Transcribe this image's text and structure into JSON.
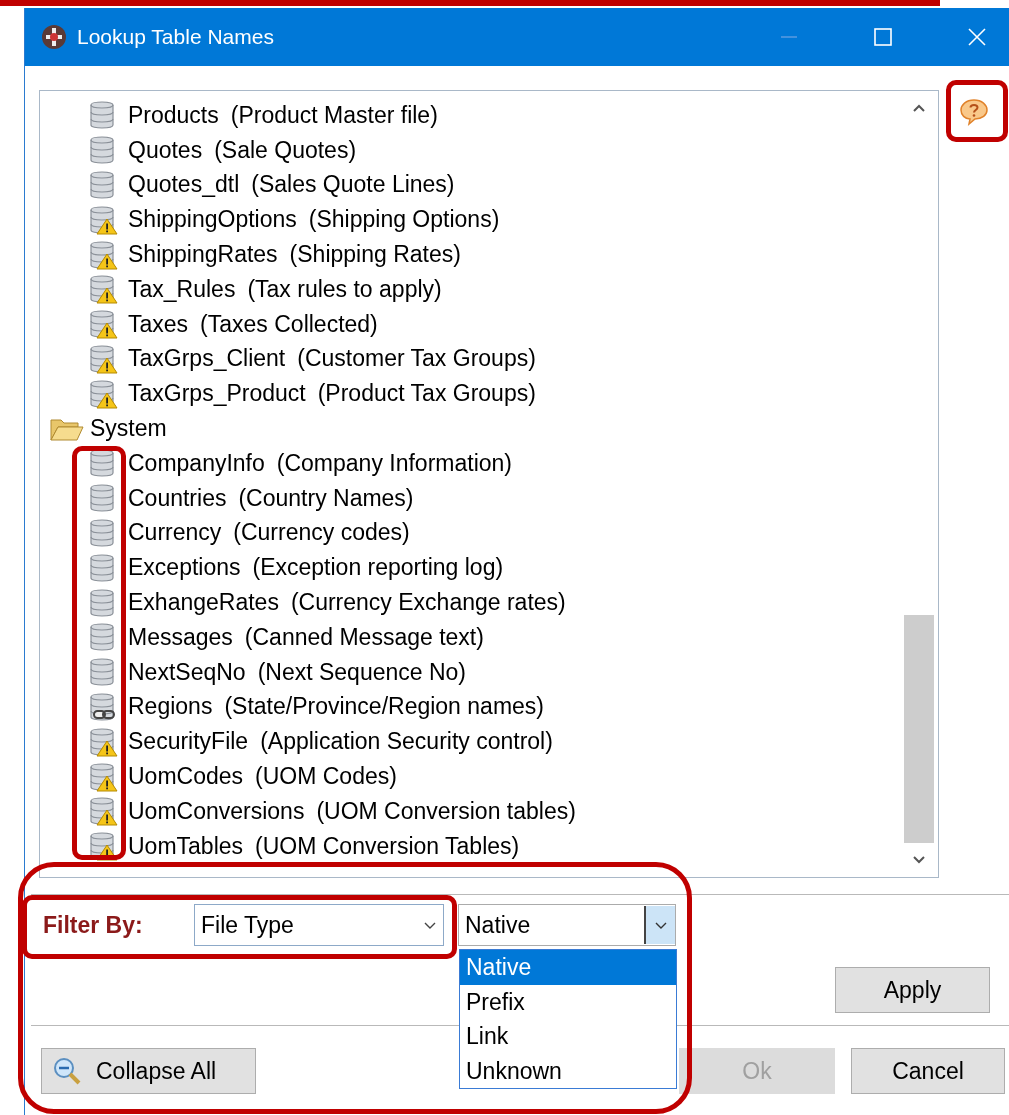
{
  "window": {
    "title": "Lookup Table Names"
  },
  "tree": {
    "continued_children": [
      {
        "kind": "table",
        "name": "Products",
        "description": "(Product Master file)"
      },
      {
        "kind": "table",
        "name": "Quotes",
        "description": "(Sale Quotes)"
      },
      {
        "kind": "table",
        "name": "Quotes_dtl",
        "description": "(Sales Quote Lines)"
      },
      {
        "kind": "warning",
        "name": "ShippingOptions",
        "description": "(Shipping Options)"
      },
      {
        "kind": "warning",
        "name": "ShippingRates",
        "description": "(Shipping Rates)"
      },
      {
        "kind": "warning",
        "name": "Tax_Rules",
        "description": "(Tax rules to apply)"
      },
      {
        "kind": "warning",
        "name": "Taxes",
        "description": "(Taxes Collected)"
      },
      {
        "kind": "warning",
        "name": "TaxGrps_Client",
        "description": "(Customer Tax Groups)"
      },
      {
        "kind": "warning",
        "name": "TaxGrps_Product",
        "description": "(Product Tax Groups)"
      }
    ],
    "folders": [
      {
        "name": "System",
        "expanded": true,
        "children": [
          {
            "kind": "table",
            "name": "CompanyInfo",
            "description": "(Company Information)"
          },
          {
            "kind": "table",
            "name": "Countries",
            "description": "(Country Names)"
          },
          {
            "kind": "table",
            "name": "Currency",
            "description": "(Currency codes)"
          },
          {
            "kind": "table",
            "name": "Exceptions",
            "description": "(Exception reporting log)"
          },
          {
            "kind": "table",
            "name": "ExhangeRates",
            "description": "(Currency Exchange rates)"
          },
          {
            "kind": "table",
            "name": "Messages",
            "description": "(Canned Message text)"
          },
          {
            "kind": "table",
            "name": "NextSeqNo",
            "description": "(Next Sequence No)"
          },
          {
            "kind": "link",
            "name": "Regions",
            "description": "(State/Province/Region names)"
          },
          {
            "kind": "warning",
            "name": "SecurityFile",
            "description": "(Application Security control)"
          },
          {
            "kind": "warning",
            "name": "UomCodes",
            "description": "(UOM Codes)"
          },
          {
            "kind": "warning",
            "name": "UomConversions",
            "description": "(UOM Conversion tables)"
          },
          {
            "kind": "warning",
            "name": "UomTables",
            "description": "(UOM Conversion Tables)"
          }
        ]
      }
    ]
  },
  "filter": {
    "label": "Filter By:",
    "field": "File Type",
    "value": "Native",
    "dropdown_open": true,
    "options": [
      {
        "label": "Native",
        "selected": true
      },
      {
        "label": "Prefix",
        "selected": false
      },
      {
        "label": "Link",
        "selected": false
      },
      {
        "label": "Unknown",
        "selected": false
      }
    ]
  },
  "buttons": [
    {
      "kind": "apply",
      "label": "Apply",
      "disabled": false
    },
    {
      "kind": "collapse",
      "label": "Collapse All",
      "disabled": false
    },
    {
      "kind": "ok",
      "label": "Ok",
      "disabled": true
    },
    {
      "kind": "cancel",
      "label": "Cancel",
      "disabled": false
    }
  ]
}
